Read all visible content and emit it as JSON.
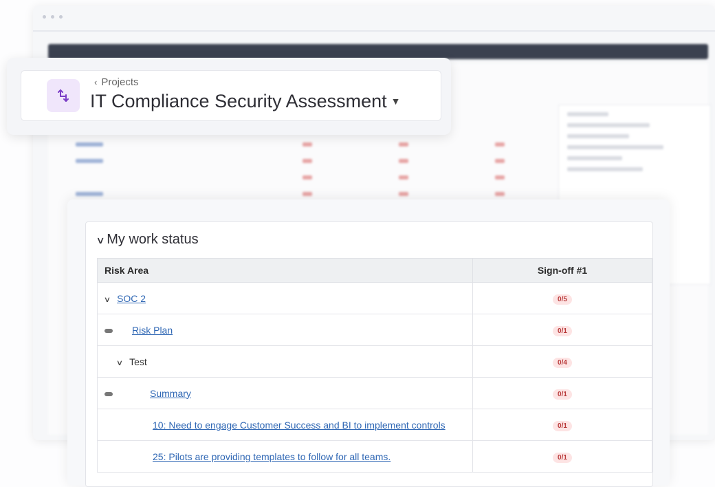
{
  "project": {
    "breadcrumb": "Projects",
    "title": "IT Compliance Security Assessment",
    "icon": "transfer-arrows-icon",
    "accent": "#7b3ec6"
  },
  "panel": {
    "title": "My work status",
    "columns": {
      "risk_area": "Risk Area",
      "signoff": "Sign-off #1"
    },
    "rows": [
      {
        "label": "SOC 2",
        "status": "0/5"
      },
      {
        "label": "Risk Plan",
        "status": "0/1"
      },
      {
        "label": "Test",
        "status": "0/4"
      },
      {
        "label": "Summary",
        "status": "0/1"
      },
      {
        "label": "10: Need to engage Customer Success and BI to implement controls",
        "status": "0/1"
      },
      {
        "label": "25: Pilots are providing templates to follow for all teams.",
        "status": "0/1"
      }
    ]
  },
  "colors": {
    "link": "#2f67b4",
    "badge_bg": "#fde4e4",
    "badge_text": "#b83a3a"
  }
}
